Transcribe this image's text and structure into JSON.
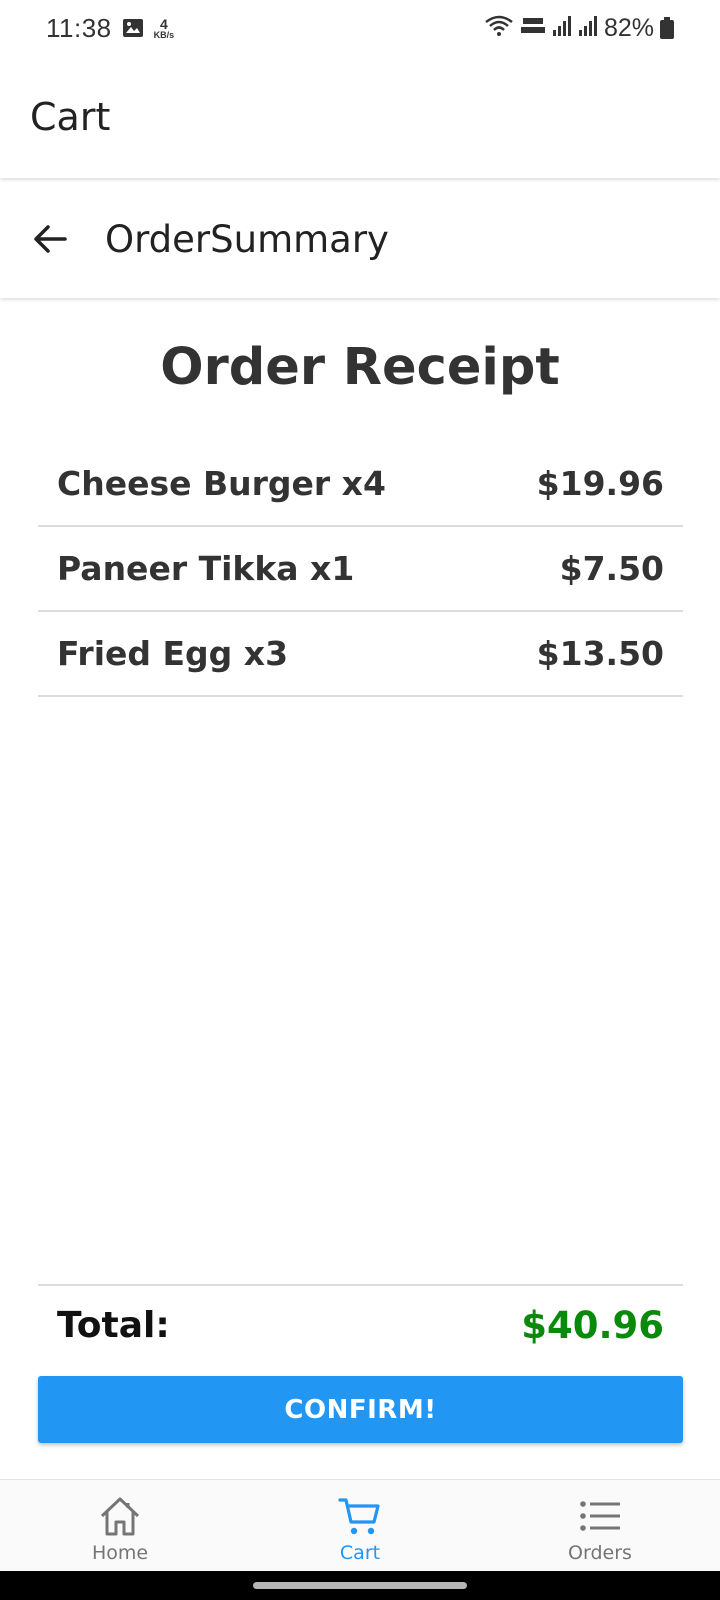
{
  "status_bar": {
    "time": "11:38",
    "net_speed_value": "4",
    "net_speed_unit": "KB/s",
    "battery_percent": "82%"
  },
  "app_bar": {
    "title": "Cart"
  },
  "sub_header": {
    "title": "OrderSummary"
  },
  "receipt": {
    "title": "Order Receipt",
    "items": [
      {
        "name": "Cheese Burger x4",
        "price": "$19.96"
      },
      {
        "name": "Paneer Tikka x1",
        "price": "$7.50"
      },
      {
        "name": "Fried Egg x3",
        "price": "$13.50"
      }
    ],
    "total_label": "Total:",
    "total_value": "$40.96"
  },
  "confirm_label": "CONFIRM!",
  "bottom_nav": {
    "items": [
      {
        "label": "Home",
        "icon": "home-icon",
        "active": false
      },
      {
        "label": "Cart",
        "icon": "cart-icon",
        "active": true
      },
      {
        "label": "Orders",
        "icon": "list-icon",
        "active": false
      }
    ]
  },
  "colors": {
    "accent": "#2196F3",
    "total_green": "#0a8a0a",
    "text_dark": "#333333",
    "nav_inactive": "#757575"
  }
}
